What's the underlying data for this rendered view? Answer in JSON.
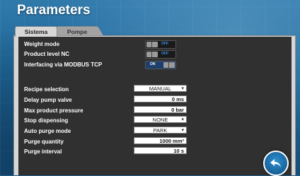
{
  "page": {
    "title": "Parameters"
  },
  "tabs": [
    {
      "label": "Sistema",
      "active": true
    },
    {
      "label": "Pompe",
      "active": false
    }
  ],
  "toggles": [
    {
      "label": "Weight mode",
      "state": "OFF"
    },
    {
      "label": "Product level NC",
      "state": "OFF"
    },
    {
      "label": "Interfacing via MODBUS TCP",
      "state": "ON"
    }
  ],
  "params": [
    {
      "label": "Recipe selection",
      "value": "MANUAL",
      "kind": "select"
    },
    {
      "label": "Delay pump valve",
      "value": "0 ms",
      "kind": "value"
    },
    {
      "label": "Max product pressure",
      "value": "0 bar",
      "kind": "value"
    },
    {
      "label": "Stop dispensing",
      "value": "NONE",
      "kind": "select"
    },
    {
      "label": "Auto purge mode",
      "value": "PARK",
      "kind": "select"
    },
    {
      "label": "Purge quantity",
      "value": "1000 mm³",
      "kind": "value"
    },
    {
      "label": "Purge interval",
      "value": "10 s",
      "kind": "value"
    }
  ],
  "icons": {
    "back": "back-arrow-icon",
    "dropdown": "chevron-down-icon"
  },
  "colors": {
    "background": "#1d6596",
    "panel": "#232323",
    "toggle_text": "#3a8fe8"
  }
}
